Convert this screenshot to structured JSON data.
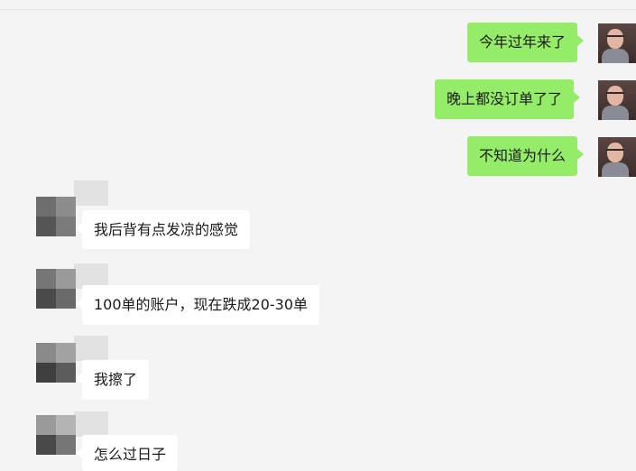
{
  "chat": {
    "messages": [
      {
        "side": "right",
        "text": "今年过年来了"
      },
      {
        "side": "right",
        "text": "晚上都没订单了了"
      },
      {
        "side": "right",
        "text": "不知道为什么"
      },
      {
        "side": "left",
        "text": "我后背有点发凉的感觉"
      },
      {
        "side": "left",
        "text": "100单的账户，现在跌成20-30单"
      },
      {
        "side": "left",
        "text": "我擦了"
      },
      {
        "side": "left",
        "text": "怎么过日子"
      }
    ]
  },
  "colors": {
    "background": "#f4f4f4",
    "outgoing_bubble": "#95ec69",
    "incoming_bubble": "#ffffff"
  }
}
